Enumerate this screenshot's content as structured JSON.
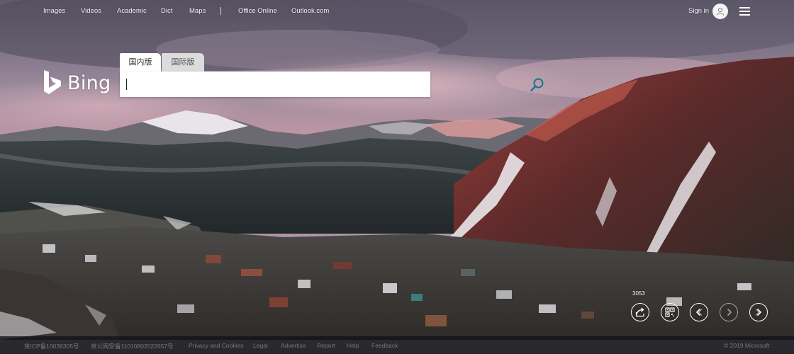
{
  "nav": {
    "links": [
      "Images",
      "Videos",
      "Academic",
      "Dict",
      "Maps"
    ],
    "links_right": [
      "Office Online",
      "Outlook.com"
    ],
    "sign_in": "Sign in"
  },
  "logo": {
    "text": "Bing"
  },
  "search": {
    "tabs": [
      "国内版",
      "国际版"
    ],
    "active_tab": "国内版",
    "value": "",
    "placeholder": ""
  },
  "carousel": {
    "counter": "3053"
  },
  "footer": {
    "links": [
      "京ICP备10036305号",
      "京公网安备11010802022657号",
      "Privacy and Cookies",
      "Legal",
      "Advertise",
      "Report",
      "Help",
      "Feedback"
    ],
    "copyright": "© 2019 Microsoft"
  },
  "icons": {
    "logo": "bing-logo-icon",
    "search": "search-icon",
    "user": "user-icon",
    "menu": "hamburger-menu-icon",
    "carousel": [
      "share-icon",
      "qr-code-icon",
      "previous-icon",
      "next-icon-faded",
      "next-icon"
    ]
  },
  "colors": {
    "nav_text": "#f2f2f2",
    "footer_bg": "#141416",
    "footer_text": "#777777",
    "tab_active_bg": "#ffffff",
    "tab_inactive_bg": "#dcdcdc",
    "search_icon": "#0f7a8a"
  }
}
